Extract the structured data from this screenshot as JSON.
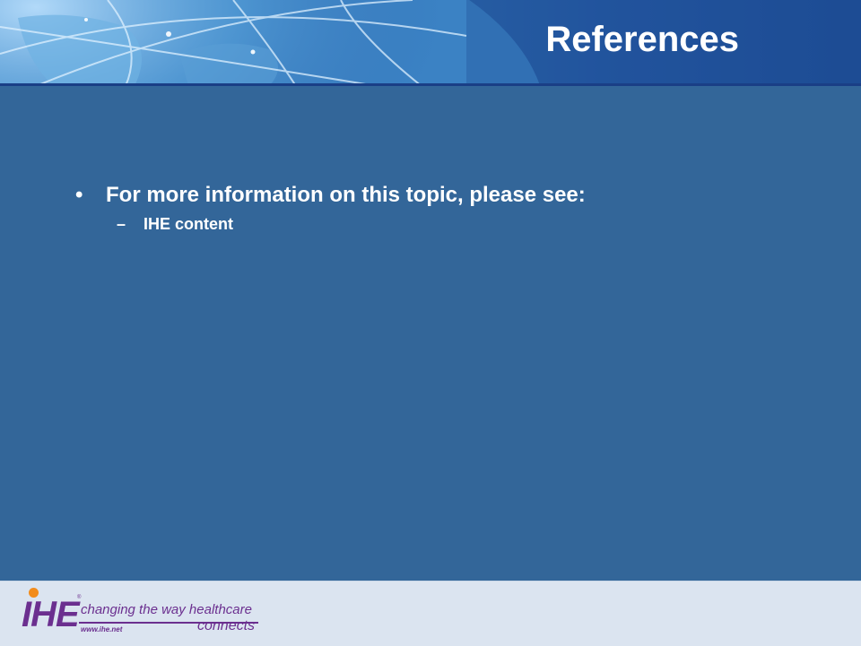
{
  "slide": {
    "title": "References",
    "bullets": [
      {
        "text": "For more information on this topic, please see:",
        "marker": "•",
        "sub_items": [
          {
            "marker": "–",
            "text": "IHE content"
          }
        ]
      }
    ]
  },
  "footer": {
    "logo": {
      "wordmark": "IHE",
      "tagline": "changing the way healthcare",
      "url": "www.ihe.net",
      "connects": "connects",
      "trademark": "®"
    }
  },
  "colors": {
    "background": "#336699",
    "header_dark": "#1c4a92",
    "footer_bg": "#dbe4f0",
    "logo_purple": "#6b2f8f",
    "logo_orange": "#f28c1c",
    "text": "#ffffff"
  },
  "icons": [
    "globe-graphic"
  ]
}
